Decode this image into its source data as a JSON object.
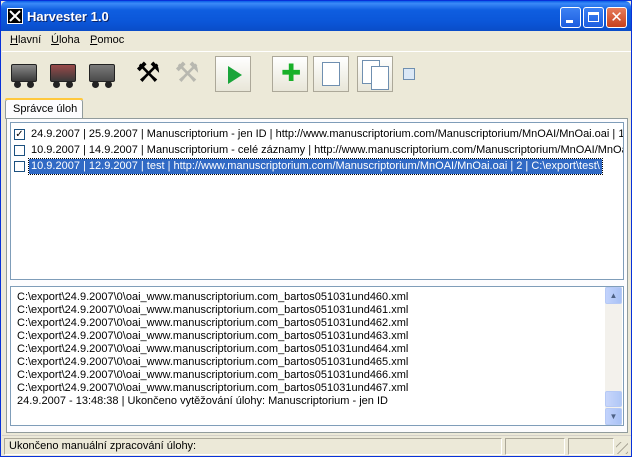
{
  "window": {
    "title": "Harvester 1.0",
    "controls": {
      "minimize_icon": "minimize-icon",
      "maximize_icon": "maximize-icon",
      "close_icon": "close-icon"
    }
  },
  "menu": [
    {
      "label": "Hlavní",
      "underline": "H"
    },
    {
      "label": "Úloha",
      "underline": "Ú"
    },
    {
      "label": "Pomoc",
      "underline": "P"
    }
  ],
  "toolbar": {
    "icons": [
      "mine-cart-icon",
      "mine-cart-red-icon",
      "mine-cart-grey-icon",
      "pickaxe-icon",
      "pickaxe-disabled-icon",
      "play-icon",
      "add-icon",
      "new-document-icon",
      "copy-document-icon",
      "small-find-icon"
    ]
  },
  "tabs": [
    {
      "label": "Správce úloh",
      "active": true
    }
  ],
  "jobs": [
    {
      "checked": true,
      "selected": false,
      "text": "24.9.2007 | 25.9.2007 | Manuscriptorium - jen ID | http://www.manuscriptorium.com/Manuscriptorium/MnOAI/MnOai.oai | 1 | C:"
    },
    {
      "checked": false,
      "selected": false,
      "text": "10.9.2007 | 14.9.2007 | Manuscriptorium - celé záznamy | http://www.manuscriptorium.com/Manuscriptorium/MnOAI/MnOai.oai"
    },
    {
      "checked": false,
      "selected": true,
      "text": "10.9.2007 | 12.9.2007 | test | http://www.manuscriptorium.com/Manuscriptorium/MnOAI/MnOai.oai | 2 | C:\\export\\test\\"
    }
  ],
  "log": [
    "C:\\export\\24.9.2007\\0\\oai_www.manuscriptorium.com_bartos051031und460.xml",
    "C:\\export\\24.9.2007\\0\\oai_www.manuscriptorium.com_bartos051031und461.xml",
    "C:\\export\\24.9.2007\\0\\oai_www.manuscriptorium.com_bartos051031und462.xml",
    "C:\\export\\24.9.2007\\0\\oai_www.manuscriptorium.com_bartos051031und463.xml",
    "C:\\export\\24.9.2007\\0\\oai_www.manuscriptorium.com_bartos051031und464.xml",
    "C:\\export\\24.9.2007\\0\\oai_www.manuscriptorium.com_bartos051031und465.xml",
    "C:\\export\\24.9.2007\\0\\oai_www.manuscriptorium.com_bartos051031und466.xml",
    "C:\\export\\24.9.2007\\0\\oai_www.manuscriptorium.com_bartos051031und467.xml",
    "24.9.2007 - 13:48:38 | Ukončeno vytěžování úlohy: Manuscriptorium - jen ID"
  ],
  "statusbar": {
    "message": "Ukončeno manuální zpracování úlohy:",
    "pane2": "",
    "pane3": ""
  },
  "colors": {
    "titlebar": "#0a56d8",
    "selection": "#316ac5",
    "window_bg": "#ece9d8"
  }
}
